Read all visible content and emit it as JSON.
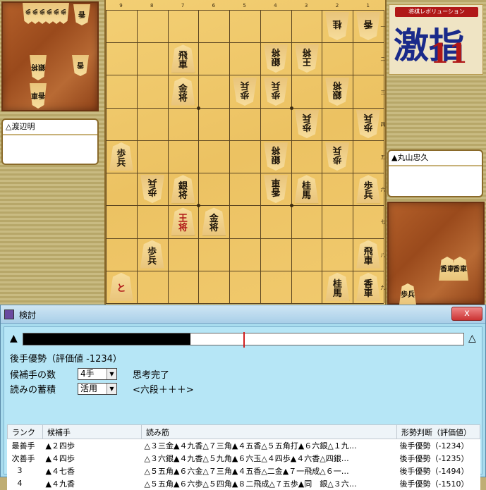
{
  "board": {
    "files": [
      "9",
      "8",
      "7",
      "6",
      "5",
      "4",
      "3",
      "2",
      "1"
    ],
    "ranks": [
      "一",
      "二",
      "三",
      "四",
      "五",
      "六",
      "七",
      "八",
      "九"
    ],
    "pieces": [
      {
        "f": 2,
        "r": 1,
        "c": "桂",
        "s": "gote"
      },
      {
        "f": 1,
        "r": 1,
        "c": "香",
        "s": "gote"
      },
      {
        "f": 7,
        "r": 2,
        "c": "飛車",
        "s": "sente"
      },
      {
        "f": 4,
        "r": 2,
        "c": "銀将",
        "s": "gote"
      },
      {
        "f": 3,
        "r": 2,
        "c": "王将",
        "s": "gote"
      },
      {
        "f": 7,
        "r": 3,
        "c": "金将",
        "s": "sente"
      },
      {
        "f": 5,
        "r": 3,
        "c": "歩兵",
        "s": "gote"
      },
      {
        "f": 4,
        "r": 3,
        "c": "歩兵",
        "s": "gote"
      },
      {
        "f": 2,
        "r": 3,
        "c": "銀将",
        "s": "gote"
      },
      {
        "f": 3,
        "r": 4,
        "c": "歩兵",
        "s": "gote"
      },
      {
        "f": 1,
        "r": 4,
        "c": "歩兵",
        "s": "gote"
      },
      {
        "f": 9,
        "r": 5,
        "c": "歩兵",
        "s": "sente"
      },
      {
        "f": 4,
        "r": 5,
        "c": "銀将",
        "s": "gote"
      },
      {
        "f": 2,
        "r": 5,
        "c": "歩兵",
        "s": "gote"
      },
      {
        "f": 8,
        "r": 6,
        "c": "歩兵",
        "s": "gote"
      },
      {
        "f": 7,
        "r": 6,
        "c": "銀将",
        "s": "sente"
      },
      {
        "f": 4,
        "r": 6,
        "c": "香車",
        "s": "gote"
      },
      {
        "f": 3,
        "r": 6,
        "c": "桂馬",
        "s": "sente"
      },
      {
        "f": 1,
        "r": 6,
        "c": "歩兵",
        "s": "sente"
      },
      {
        "f": 7,
        "r": 7,
        "c": "王将",
        "s": "sente",
        "promoted": true
      },
      {
        "f": 6,
        "r": 7,
        "c": "金将",
        "s": "sente"
      },
      {
        "f": 8,
        "r": 8,
        "c": "歩兵",
        "s": "sente"
      },
      {
        "f": 1,
        "r": 8,
        "c": "飛車",
        "s": "sente"
      },
      {
        "f": 9,
        "r": 9,
        "c": "と",
        "s": "sente",
        "promoted": true
      },
      {
        "f": 2,
        "r": 9,
        "c": "桂馬",
        "s": "sente"
      },
      {
        "f": 1,
        "r": 9,
        "c": "香車",
        "s": "sente"
      }
    ]
  },
  "gote_hand": {
    "row_label": "歩歩歩歩歩歩",
    "pieces": [
      "香",
      "銀将",
      "香",
      "香車"
    ]
  },
  "sente_hand": {
    "pieces": [
      "香車",
      "香車",
      "歩兵"
    ]
  },
  "players": {
    "gote": "△渡辺明",
    "sente": "▲丸山忠久"
  },
  "logo": {
    "ribbon": "将棋レボリューション",
    "text": "激指",
    "number": "11"
  },
  "window": {
    "title": "検討",
    "close": "x"
  },
  "eval": {
    "left_symbol": "▲",
    "right_symbol": "△",
    "fill_fraction": 0.38,
    "marker_fraction": 0.5,
    "status": "後手優勢（評価値 -1234）"
  },
  "settings": {
    "candidates_label": "候補手の数",
    "candidates_value": "4手",
    "accumulate_label": "読みの蓄積",
    "accumulate_value": "活用",
    "think_status": "思考完了",
    "level": "<六段＋＋＋>"
  },
  "table": {
    "headers": [
      "ランク",
      "候補手",
      "読み筋",
      "形勢判断（評価値）"
    ],
    "rows": [
      {
        "rank": "最善手",
        "move": "▲２四歩",
        "line": "△３三金▲４九香△７三角▲４五香△５五角打▲６六銀△１九…",
        "judge": "後手優勢（-1234）"
      },
      {
        "rank": "次善手",
        "move": "▲４四歩",
        "line": "△３六銀▲４九香△５九角▲６六玉△４四歩▲４六香△四銀…",
        "judge": "後手優勢（-1235）"
      },
      {
        "rank": "3",
        "move": "▲４七香",
        "line": "△５五角▲６六金△７三角▲４五香△二金▲７一飛成△６一…",
        "judge": "後手優勢（-1494）"
      },
      {
        "rank": "4",
        "move": "▲４九香",
        "line": "△５五角▲６六歩△５四角▲８二飛成△７五歩▲同　銀△３六…",
        "judge": "後手優勢（-1510）"
      }
    ]
  }
}
